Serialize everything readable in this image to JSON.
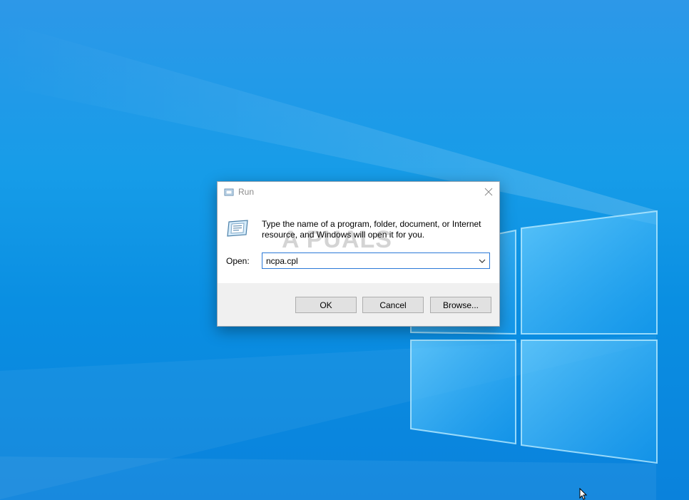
{
  "dialog": {
    "title": "Run",
    "description": "Type the name of a program, folder, document, or Internet resource, and Windows will open it for you.",
    "open_label": "Open:",
    "open_value": "ncpa.cpl",
    "watermark": "A PUALS",
    "buttons": {
      "ok": "OK",
      "cancel": "Cancel",
      "browse": "Browse..."
    }
  },
  "icons": {
    "title": "run-icon",
    "body": "run-icon",
    "close": "close-icon",
    "dropdown": "chevron-down-icon",
    "cursor": "mouse-pointer-icon"
  },
  "colors": {
    "desktop_blue": "#0a8fe2",
    "combo_border": "#2b79d8",
    "footer_bg": "#f0f0f0",
    "button_bg": "#e1e1e1"
  }
}
